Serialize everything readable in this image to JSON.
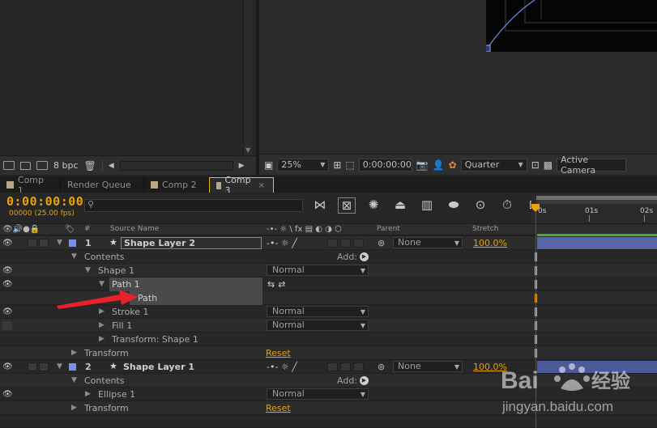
{
  "project_panel": {
    "bpc": "8 bpc"
  },
  "viewer": {
    "zoom": "25%",
    "timecode": "0:00:00:00",
    "resolution": "Quarter",
    "camera": "Active Camera"
  },
  "tabs": [
    {
      "label": "Comp 1",
      "active": false,
      "has_swatch": true
    },
    {
      "label": "Render Queue",
      "active": false,
      "has_swatch": false
    },
    {
      "label": "Comp 2",
      "active": false,
      "has_swatch": true
    },
    {
      "label": "Comp 3",
      "active": true,
      "has_swatch": true
    }
  ],
  "timeline": {
    "timecode": "0:00:00:00",
    "frame_info": "00000 (25.00 fps)",
    "ruler": {
      "start": "0s",
      "mark1": "01s",
      "mark2": "02s"
    }
  },
  "columns": {
    "hash": "#",
    "source_name": "Source Name",
    "parent": "Parent",
    "stretch": "Stretch"
  },
  "rows": {
    "layer1": {
      "num": "1",
      "name": "Shape Layer 2",
      "parent": "None",
      "stretch": "100.0%"
    },
    "contents1": {
      "label": "Contents",
      "add": "Add:"
    },
    "shape1": {
      "label": "Shape 1",
      "mode": "Normal"
    },
    "path1": {
      "label": "Path 1"
    },
    "path": {
      "label": "Path"
    },
    "stroke1": {
      "label": "Stroke 1",
      "mode": "Normal"
    },
    "fill1": {
      "label": "Fill 1",
      "mode": "Normal"
    },
    "transform_shape": {
      "label": "Transform: Shape 1"
    },
    "transform1": {
      "label": "Transform",
      "reset": "Reset"
    },
    "layer2": {
      "num": "2",
      "name": "Shape Layer 1",
      "parent": "None",
      "stretch": "100.0%"
    },
    "contents2": {
      "label": "Contents",
      "add": "Add:"
    },
    "ellipse1": {
      "label": "Ellipse 1",
      "mode": "Normal"
    },
    "transform2": {
      "label": "Transform",
      "reset": "Reset"
    }
  },
  "watermark": {
    "brand_a": "Bai",
    "brand_b": "经验",
    "url": "jingyan.baidu.com"
  },
  "colors": {
    "timecode": "#e8a20a",
    "label_swatch": "#7c8fe8",
    "layer_bar": "#5865a8",
    "cti": "#d41f1f",
    "arrow": "#e8212b"
  }
}
